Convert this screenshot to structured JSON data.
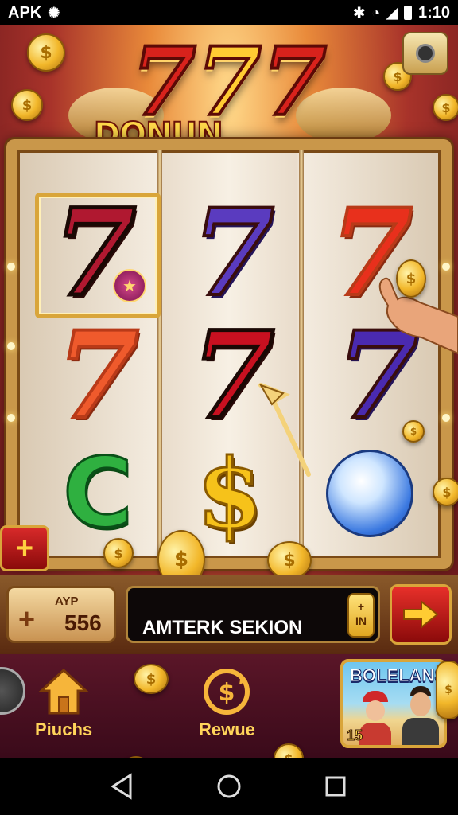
{
  "status_bar": {
    "app_label": "APK",
    "time": "1:10"
  },
  "game": {
    "title_sevens": [
      "7",
      "7",
      "7"
    ],
    "title": "DONUN IGANGA",
    "reels": [
      [
        "7",
        "7",
        "C"
      ],
      [
        "7",
        "7",
        "$"
      ],
      [
        "7",
        "7",
        ""
      ]
    ],
    "badge_icon": "star-icon"
  },
  "controls": {
    "bet_label": "AYP",
    "bet_plus": "+",
    "bet_value": "556",
    "message": "AMTERK SEKION",
    "toggle_top": "+",
    "toggle_bottom": "IN",
    "side_plus": "+"
  },
  "nav": {
    "items": [
      {
        "label": "Piuchs",
        "icon": "house-icon"
      },
      {
        "label": "Rewue",
        "icon": "dollar-cycle-icon"
      }
    ],
    "promo": {
      "title": "BOLELANS",
      "number": "15"
    }
  }
}
